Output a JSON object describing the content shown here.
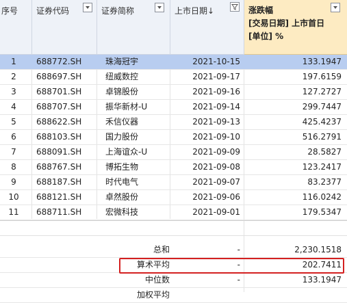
{
  "columns": {
    "no": "序号",
    "code": "证券代码",
    "name": "证券简称",
    "date": "上市日期",
    "date_sort_arrow": "↓",
    "change_line1": "涨跌幅",
    "change_line2": "[交易日期] 上市首日",
    "change_line3": "[单位] %"
  },
  "rows": [
    {
      "no": "1",
      "code": "688772.SH",
      "name": "珠海冠宇",
      "date": "2021-10-15",
      "change": "133.1947"
    },
    {
      "no": "2",
      "code": "688697.SH",
      "name": "纽威数控",
      "date": "2021-09-17",
      "change": "197.6159"
    },
    {
      "no": "3",
      "code": "688701.SH",
      "name": "卓锦股份",
      "date": "2021-09-16",
      "change": "127.2727"
    },
    {
      "no": "4",
      "code": "688707.SH",
      "name": "振华新材-U",
      "date": "2021-09-14",
      "change": "299.7447"
    },
    {
      "no": "5",
      "code": "688622.SH",
      "name": "禾信仪器",
      "date": "2021-09-13",
      "change": "425.4237"
    },
    {
      "no": "6",
      "code": "688103.SH",
      "name": "国力股份",
      "date": "2021-09-10",
      "change": "516.2791"
    },
    {
      "no": "7",
      "code": "688091.SH",
      "name": "上海谊众-U",
      "date": "2021-09-09",
      "change": "28.5827"
    },
    {
      "no": "8",
      "code": "688767.SH",
      "name": "博拓生物",
      "date": "2021-09-08",
      "change": "123.2417"
    },
    {
      "no": "9",
      "code": "688187.SH",
      "name": "时代电气",
      "date": "2021-09-07",
      "change": "83.2377"
    },
    {
      "no": "10",
      "code": "688121.SH",
      "name": "卓然股份",
      "date": "2021-09-06",
      "change": "116.0242"
    },
    {
      "no": "11",
      "code": "688711.SH",
      "name": "宏微科技",
      "date": "2021-09-01",
      "change": "179.5347"
    }
  ],
  "summary": [
    {
      "label": "总和",
      "dash": "-",
      "value": "2,230.1518"
    },
    {
      "label": "算术平均",
      "dash": "-",
      "value": "202.7411"
    },
    {
      "label": "中位数",
      "dash": "-",
      "value": "133.1947"
    },
    {
      "label": "加权平均",
      "dash": "",
      "value": ""
    }
  ],
  "colors": {
    "selected_row": "#b8cdf0",
    "accent_header": "#fdebc2",
    "highlight": "#d42020"
  }
}
